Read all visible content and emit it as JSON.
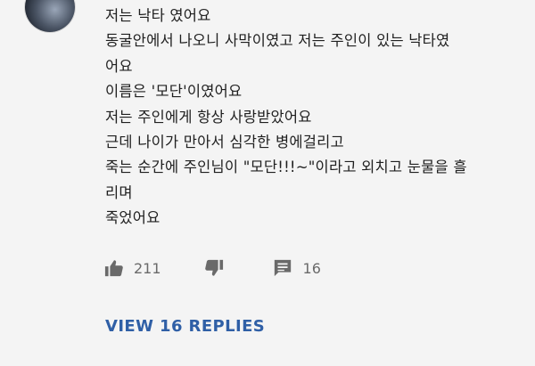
{
  "comment": {
    "lines": [
      "저는 낙타 였어요",
      "동굴안에서 나오니 사막이였고 저는 주인이 있는 낙타였",
      "어요",
      "이름은 '모단'이였어요",
      "저는 주인에게 항상 사랑받았어요",
      "근데 나이가 만아서 심각한 병에걸리고",
      "죽는 순간에  주인님이 \"모단!!!~\"이라고 외치고 눈물을 흘",
      "리며",
      "죽었어요"
    ]
  },
  "actions": {
    "like_count": "211",
    "reply_count": "16",
    "icons": [
      "thumbs-up-icon",
      "thumbs-down-icon",
      "reply-icon"
    ]
  },
  "view_replies_label": "VIEW 16 REPLIES",
  "colors": {
    "background": "#f4f4f4",
    "text": "#1f1f1f",
    "muted": "#6a6a6a",
    "link": "#2f5fa6"
  }
}
